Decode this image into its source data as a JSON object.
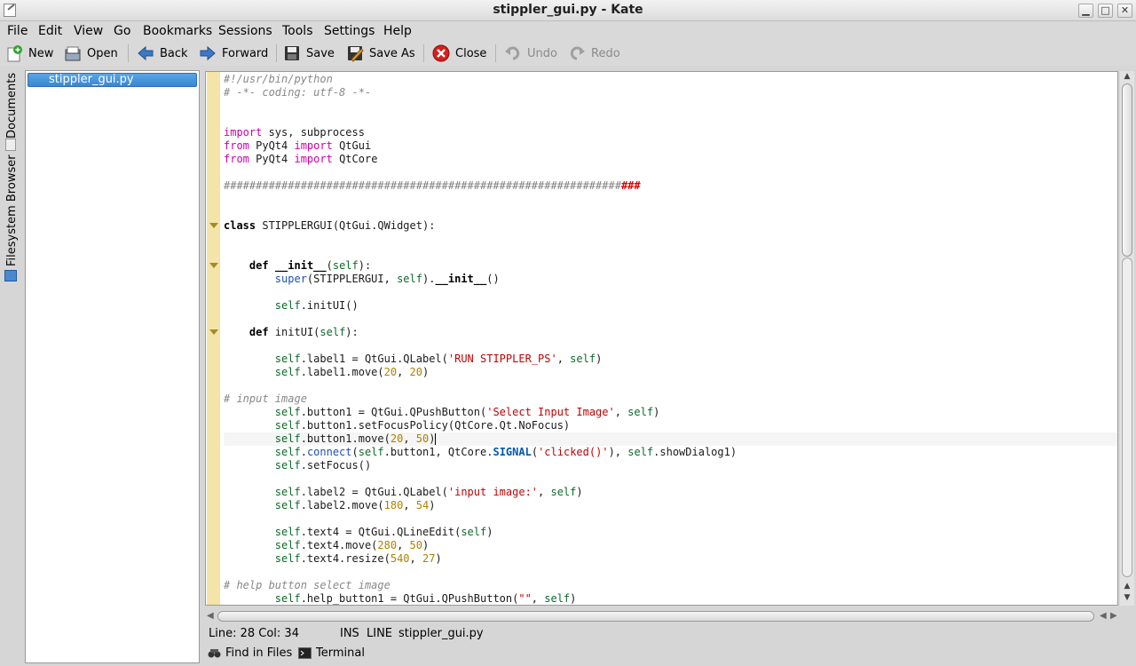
{
  "window": {
    "title": "stippler_gui.py - Kate",
    "minimize": "▁",
    "maximize": "□",
    "close": "✕"
  },
  "menubar": [
    "File",
    "Edit",
    "View",
    "Go",
    "Bookmarks",
    "Sessions",
    "Tools",
    "Settings",
    "Help"
  ],
  "toolbar": {
    "new": "New",
    "open": "Open",
    "back": "Back",
    "forward": "Forward",
    "save": "Save",
    "save_as": "Save As",
    "close": "Close",
    "undo": "Undo",
    "redo": "Redo"
  },
  "side_tabs": {
    "documents": "Documents",
    "filesystem": "Filesystem Browser"
  },
  "documents": [
    "stippler_gui.py"
  ],
  "editor": {
    "current_line_index": 27,
    "lines": [
      "#!/usr/bin/python",
      "# -*- coding: utf-8 -*-",
      "",
      "",
      "import sys, subprocess",
      "from PyQt4 import QtGui",
      "from PyQt4 import QtCore",
      "",
      "#################################################################",
      "",
      "",
      "class STIPPLERGUI(QtGui.QWidget):",
      "",
      "",
      "    def __init__(self):",
      "        super(STIPPLERGUI, self).__init__()",
      "",
      "        self.initUI()",
      "",
      "    def initUI(self):",
      "",
      "        self.label1 = QtGui.QLabel('RUN STIPPLER_PS', self)",
      "        self.label1.move(20, 20)",
      "",
      "# input image",
      "        self.button1 = QtGui.QPushButton('Select Input Image', self)",
      "        self.button1.setFocusPolicy(QtCore.Qt.NoFocus)",
      "        self.button1.move(20, 50)",
      "        self.connect(self.button1, QtCore.SIGNAL('clicked()'), self.showDialog1)",
      "        self.setFocus()",
      "",
      "        self.label2 = QtGui.QLabel('input image:', self)",
      "        self.label2.move(180, 54)",
      "",
      "        self.text4 = QtGui.QLineEdit(self)",
      "        self.text4.move(280, 50)",
      "        self.text4.resize(540, 27)",
      "",
      "# help button select image",
      "        self.help_button1 = QtGui.QPushButton(\"\", self)"
    ]
  },
  "status": {
    "position": "Line: 28 Col: 34",
    "mode": "INS",
    "selection": "LINE",
    "filename": "stippler_gui.py"
  },
  "bottom_tabs": {
    "find": "Find in Files",
    "terminal": "Terminal"
  }
}
